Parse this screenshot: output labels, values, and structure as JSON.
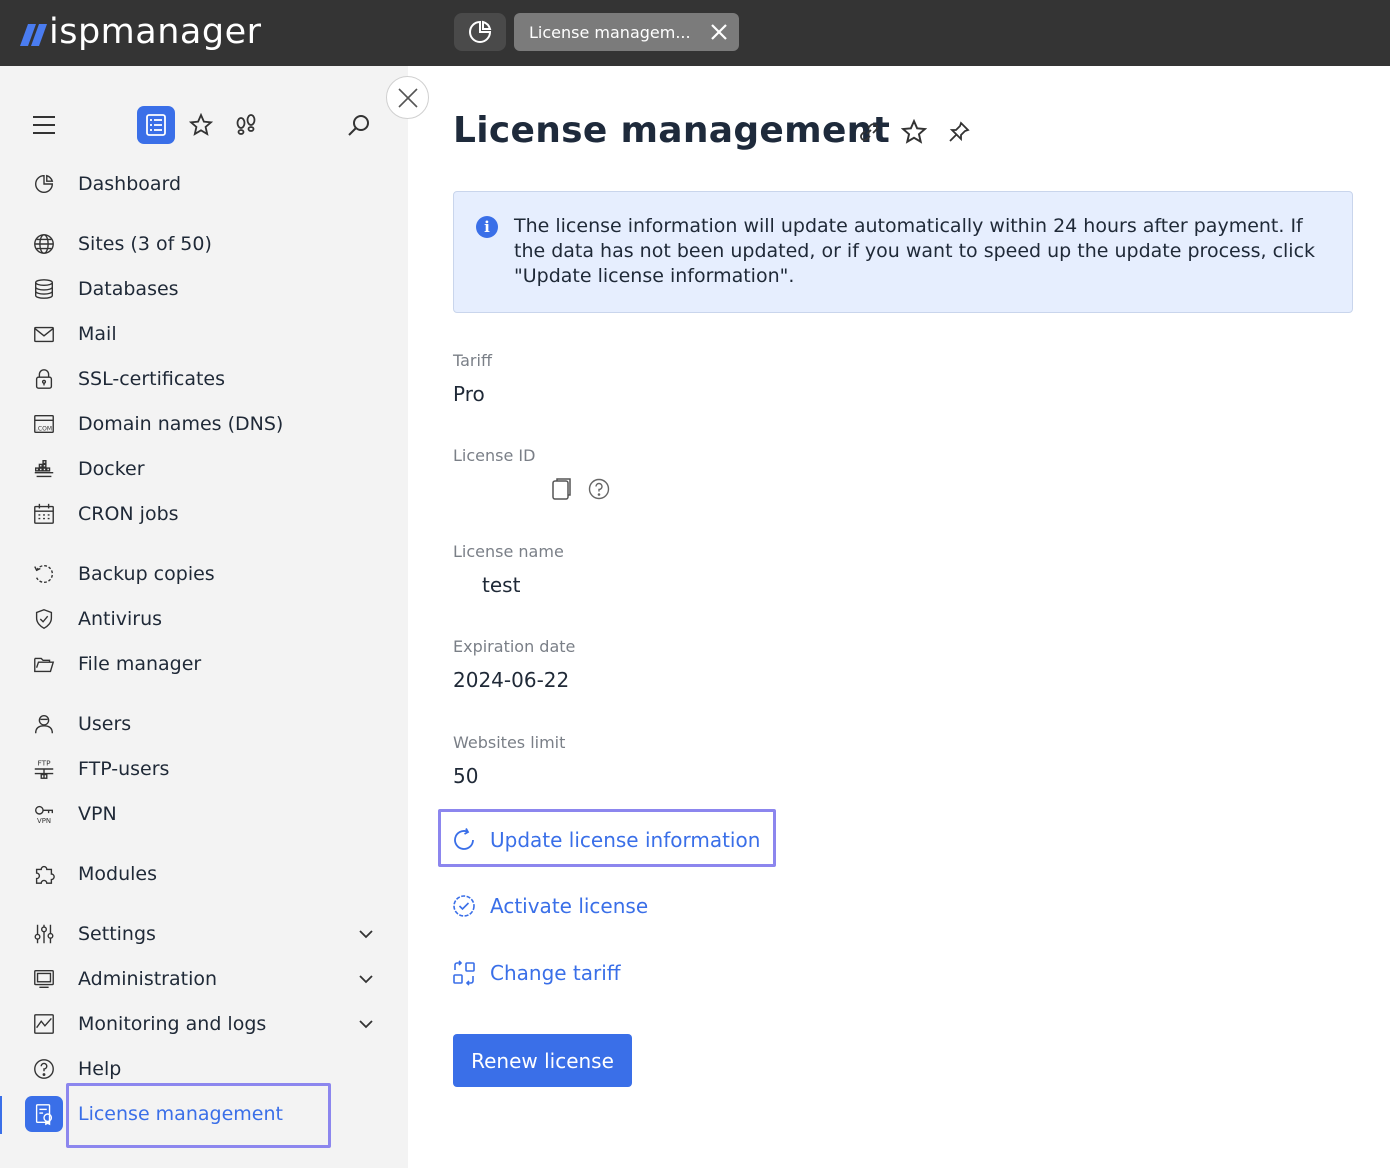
{
  "brand": {
    "logo_text": "ispmanager"
  },
  "tabs": {
    "active_tab_label": "License managem..."
  },
  "sidebar": {
    "items": [
      {
        "label": "Dashboard",
        "icon": "dashboard-icon"
      },
      {
        "label": "Sites (3 of 50)",
        "icon": "globe-icon"
      },
      {
        "label": "Databases",
        "icon": "database-icon"
      },
      {
        "label": "Mail",
        "icon": "mail-icon"
      },
      {
        "label": "SSL-certificates",
        "icon": "lock-icon"
      },
      {
        "label": "Domain names (DNS)",
        "icon": "dns-icon"
      },
      {
        "label": "Docker",
        "icon": "docker-icon"
      },
      {
        "label": "CRON jobs",
        "icon": "calendar-icon"
      },
      {
        "label": "Backup copies",
        "icon": "backup-icon"
      },
      {
        "label": "Antivirus",
        "icon": "shield-icon"
      },
      {
        "label": "File manager",
        "icon": "folder-icon"
      },
      {
        "label": "Users",
        "icon": "user-icon"
      },
      {
        "label": "FTP-users",
        "icon": "ftp-icon"
      },
      {
        "label": "VPN",
        "icon": "vpn-icon"
      },
      {
        "label": "Modules",
        "icon": "puzzle-icon"
      },
      {
        "label": "Settings",
        "icon": "sliders-icon"
      },
      {
        "label": "Administration",
        "icon": "monitor-icon"
      },
      {
        "label": "Monitoring and logs",
        "icon": "chart-icon"
      },
      {
        "label": "Help",
        "icon": "help-icon"
      },
      {
        "label": "License management",
        "icon": "license-icon"
      }
    ]
  },
  "main": {
    "title": "License management",
    "info": "The license information will update automatically within 24 hours after payment. If the data has not been updated, or if you want to speed up the update process, click \"Update license information\".",
    "fields": {
      "tariff_label": "Tariff",
      "tariff_value": "Pro",
      "license_id_label": "License ID",
      "license_name_label": "License name",
      "license_name_value": "test",
      "expiration_label": "Expiration date",
      "expiration_value": "2024-06-22",
      "websites_label": "Websites limit",
      "websites_value": "50"
    },
    "actions": {
      "update": "Update license information",
      "activate": "Activate license",
      "change": "Change tariff"
    },
    "renew_button": "Renew license"
  },
  "colors": {
    "accent": "#3a6fe8",
    "topbar": "#343434",
    "sidebar": "#f3f3f3",
    "highlight": "#8c86ee"
  }
}
